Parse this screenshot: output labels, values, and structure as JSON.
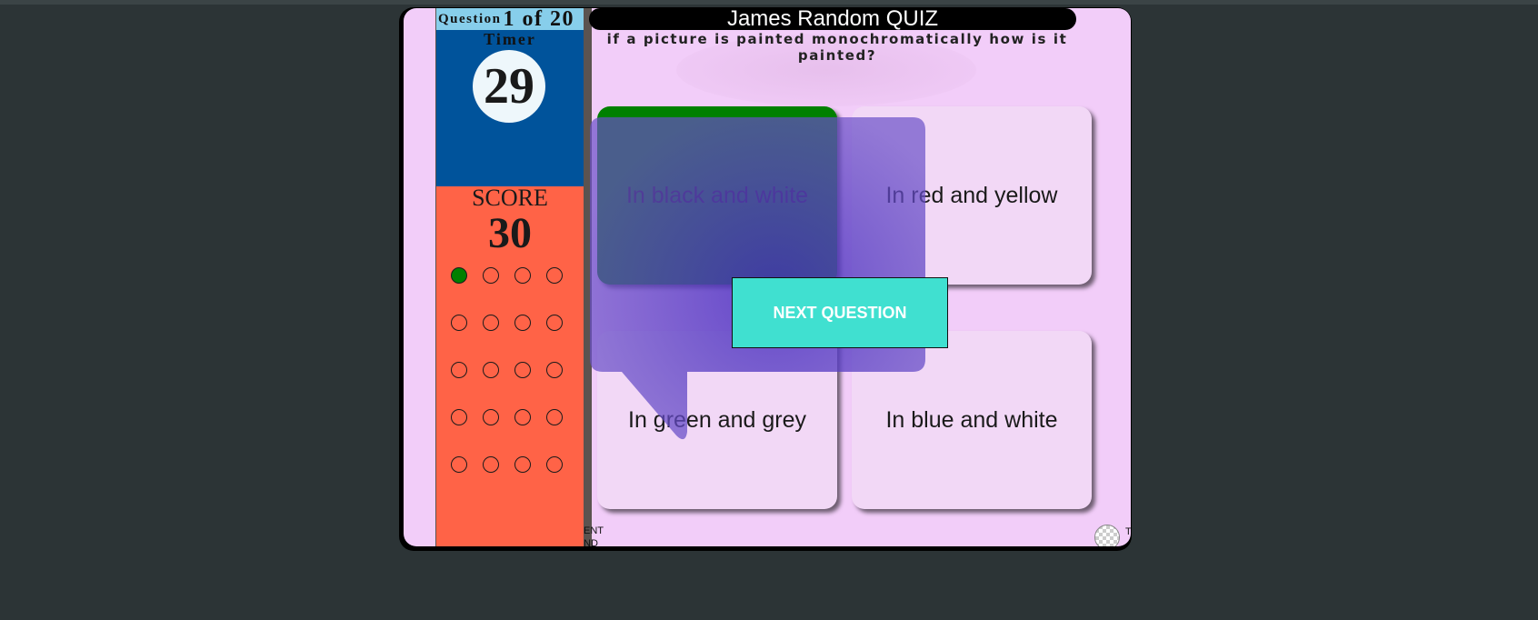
{
  "quiz": {
    "title": "James Random QUIZ",
    "question_label": "Question",
    "question_count": "1 of 20",
    "timer_label": "Timer",
    "timer_value": "29",
    "score_label": "SCORE",
    "score_value": "30",
    "question_text": "if a picture is painted monochromatically how is it painted?",
    "answers": [
      {
        "label": "In black and white",
        "state": "correct"
      },
      {
        "label": "In red and yellow",
        "state": "default"
      },
      {
        "label": "In green and grey",
        "state": "default"
      },
      {
        "label": "In blue and white",
        "state": "default"
      }
    ],
    "progress": [
      "correct",
      "empty",
      "empty",
      "empty",
      "empty",
      "empty",
      "empty",
      "empty",
      "empty",
      "empty",
      "empty",
      "empty",
      "empty",
      "empty",
      "empty",
      "empty",
      "empty",
      "empty",
      "empty",
      "empty"
    ],
    "next_label": "NEXT QUESTION",
    "footer_left": "ENT\nND",
    "footer_right": "T"
  },
  "colors": {
    "panel": "#f2cdf9",
    "timer_panel": "#00539b",
    "score_panel": "#ff6347",
    "question_bar": "#87ceeb",
    "correct": "#008000",
    "next_button": "#40e0d0",
    "bubble": "#6a50c8"
  }
}
